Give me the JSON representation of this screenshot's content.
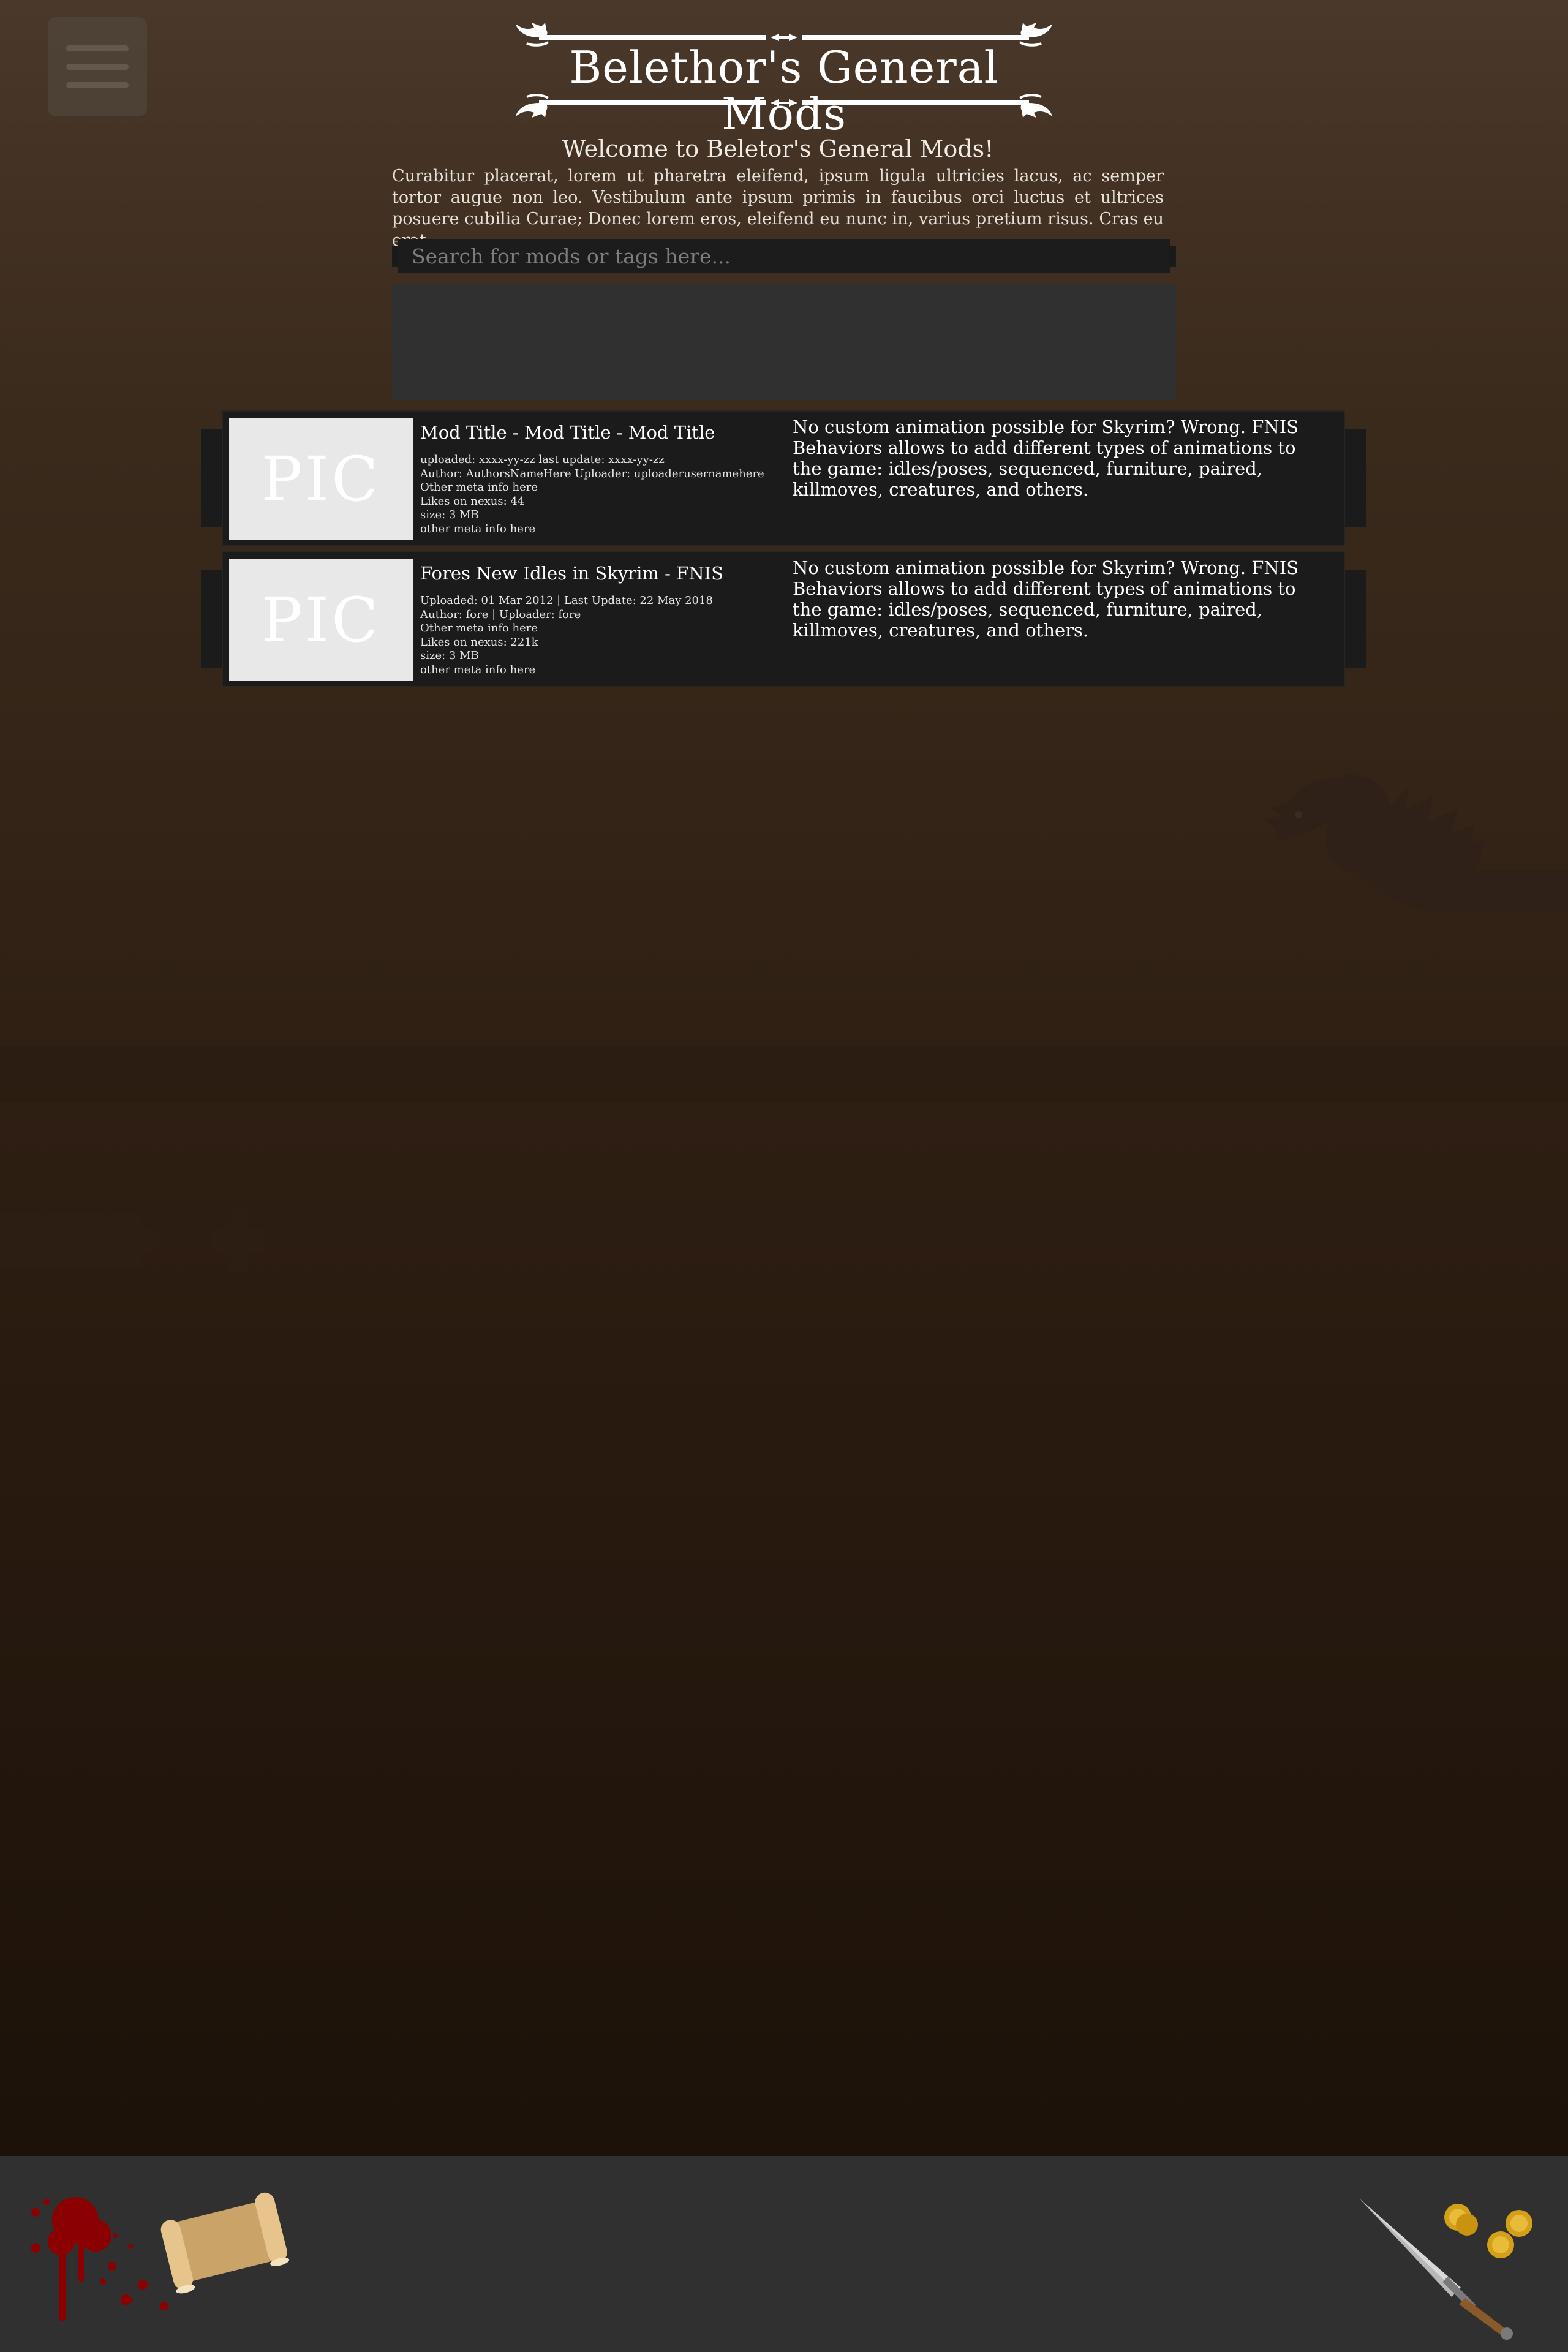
{
  "menu": {
    "icon": "hamburger-menu-icon"
  },
  "header": {
    "title": "Belethor's General Mods",
    "ornament_icon": "dragon-scroll-ornament"
  },
  "intro": {
    "heading": "Welcome to Beletor's General Mods!",
    "body": "Curabitur placerat, lorem ut pharetra eleifend, ipsum ligula ultricies lacus, ac semper tortor augue non leo. Vestibulum ante ipsum primis in faucibus orci luctus et ultrices posuere cubilia Curae; Donec lorem eros, eleifend eu nunc in, varius pretium risus. Cras eu erat"
  },
  "search": {
    "placeholder": "Search for mods or tags here...",
    "value": ""
  },
  "mods": [
    {
      "pic_label": "PIC",
      "title": "Mod Title - Mod Title - Mod Title",
      "meta": [
        "uploaded: xxxx-yy-zz last update: xxxx-yy-zz",
        "Author: AuthorsNameHere Uploader: uploaderusernamehere",
        "Other meta info here",
        "Likes on nexus: 44",
        "size: 3 MB",
        "other meta info here"
      ],
      "description": "No custom animation possible for Skyrim? Wrong. FNIS Behaviors allows to add different types of animations to the game: idles/poses, sequenced, furniture, paired, killmoves, creatures, and others."
    },
    {
      "pic_label": "PIC",
      "title": "Fores New Idles in Skyrim - FNIS",
      "meta": [
        "Uploaded: 01 Mar 2012  |  Last Update: 22 May 2018",
        "Author: fore  |  Uploader: fore",
        "Other meta info here",
        "Likes on nexus: 221k",
        "size: 3 MB",
        "other meta info here"
      ],
      "description": "No custom animation possible for Skyrim? Wrong. FNIS Behaviors allows to add different types of animations to the game: idles/poses, sequenced, furniture, paired, killmoves, creatures, and others."
    }
  ],
  "footer": {
    "icons": [
      "blood-splatter-icon",
      "scroll-icon",
      "dagger-icon",
      "gold-coins-icon"
    ]
  },
  "colors": {
    "background_top": "#4a382a",
    "background_bottom": "#1c1209",
    "card": "#1b1b1b",
    "panel": "#303030",
    "footer": "#303030",
    "pic_placeholder": "#e8e8e8",
    "blood": "#8b0000",
    "gold": "#d4a017"
  }
}
